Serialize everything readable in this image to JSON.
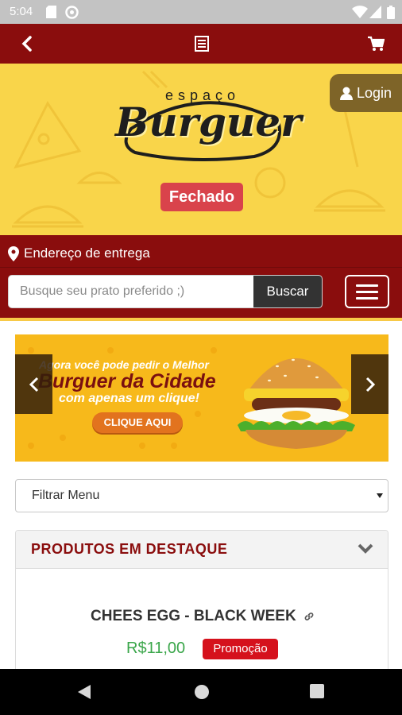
{
  "status_bar": {
    "time": "5:04",
    "icons": [
      "sd-card-icon",
      "data-saver-icon",
      "wifi-icon",
      "signal-icon",
      "battery-icon"
    ]
  },
  "top_bar": {
    "back_icon": "chevron-left-icon",
    "menu_icon": "list-document-icon",
    "cart_icon": "cart-icon",
    "background": "#8a0d0d"
  },
  "hero": {
    "logo_small_text": "espaço",
    "logo_main_text": "Burguer",
    "status": "Fechado",
    "background": "#f9d54a",
    "status_color": "#d9434b"
  },
  "login": {
    "label": "Login",
    "icon": "user-icon"
  },
  "delivery": {
    "address_label": "Endereço de entrega",
    "address_icon": "map-pin-icon"
  },
  "search": {
    "placeholder": "Busque seu prato preferido ;)",
    "value": "",
    "button_label": "Buscar"
  },
  "banner": {
    "line1": "Agora você pode pedir o Melhor",
    "line2": "Burguer da Cidade",
    "line3": "com apenas um clique!",
    "cta": "CLIQUE AQUI"
  },
  "filter": {
    "selected": "Filtrar Menu"
  },
  "featured": {
    "title": "PRODUTOS EM DESTAQUE",
    "products": [
      {
        "name": "CHEES EGG - BLACK WEEK",
        "price": "R$11,00",
        "badge": "Promoção"
      }
    ]
  },
  "colors": {
    "accent": "#8a0d0d",
    "price": "#3aa64a",
    "promo": "#d5111c",
    "highlight": "#f7c948"
  }
}
